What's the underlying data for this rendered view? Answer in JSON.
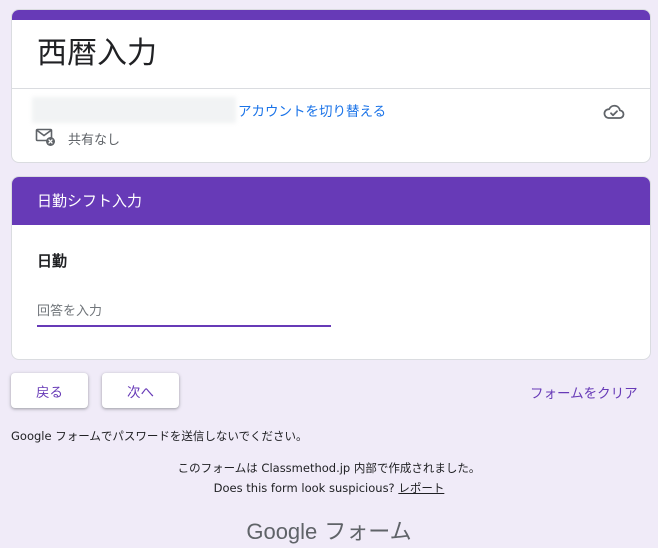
{
  "form": {
    "title": "西暦入力",
    "switch_account": "アカウントを切り替える",
    "share_status": "共有なし"
  },
  "section": {
    "title": "日勤シフト入力",
    "question": "日勤",
    "answer_placeholder": "回答を入力",
    "answer_value": ""
  },
  "nav": {
    "back": "戻る",
    "next": "次へ",
    "clear": "フォームをクリア"
  },
  "footer": {
    "password_warning": "Google フォームでパスワードを送信しないでください。",
    "created_by": "このフォームは Classmethod.jp 内部で作成されました。",
    "suspicious_prefix": "Does this form look suspicious?",
    "report": "レポート",
    "logo_google": "Google",
    "logo_forms": "フォーム"
  },
  "icons": {
    "cloud": "cloud-done-icon",
    "share": "mail-off-icon"
  },
  "colors": {
    "accent": "#673ab7",
    "background": "#f0ebf8",
    "link": "#1a73e8"
  }
}
